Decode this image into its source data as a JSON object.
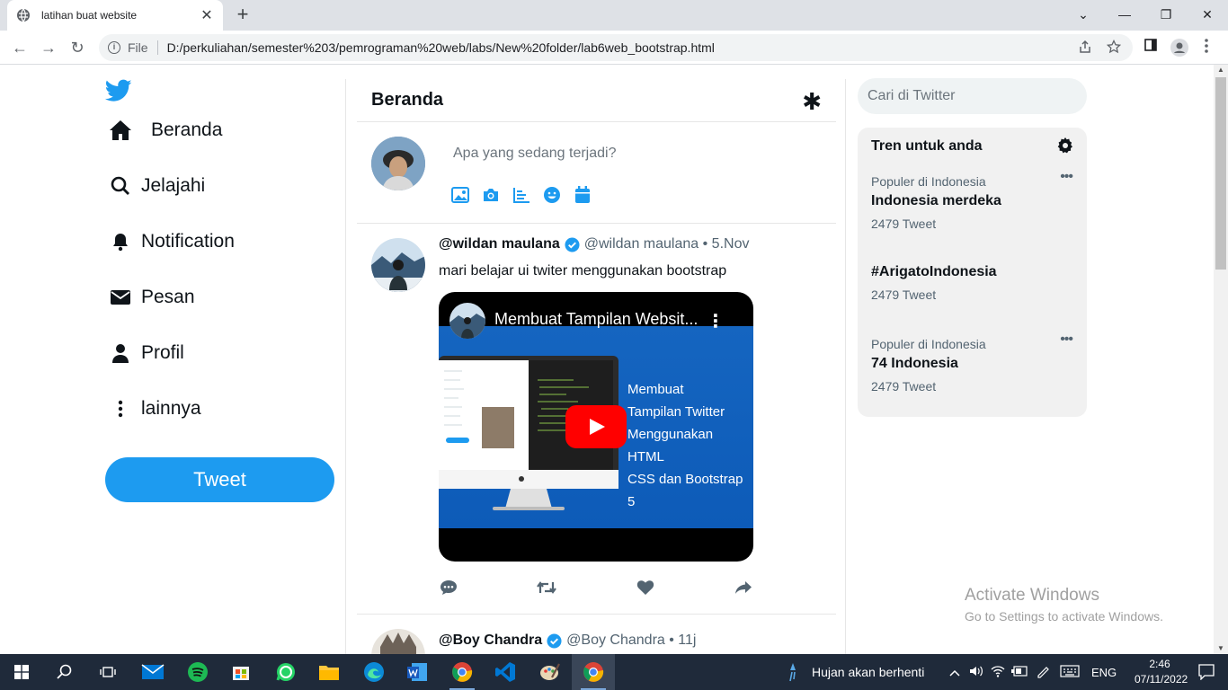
{
  "browser": {
    "tab_title": "latihan buat website",
    "tab_close": "✕",
    "new_tab": "+",
    "window_controls": [
      "⌄",
      "—",
      "❐",
      "✕"
    ],
    "nav": {
      "back": "←",
      "forward": "→",
      "reload": "↻"
    },
    "file_label": "File",
    "url": "D:/perkuliahan/semester%203/pemrograman%20web/labs/New%20folder/lab6web_bootstrap.html",
    "icons": [
      "share-icon",
      "star-icon",
      "sidebar-icon",
      "profile-icon",
      "menu-icon"
    ]
  },
  "sidebar": {
    "items": [
      {
        "label": "Beranda",
        "icon": "home-icon"
      },
      {
        "label": "Jelajahi",
        "icon": "search-icon"
      },
      {
        "label": "Notification",
        "icon": "bell-icon"
      },
      {
        "label": "Pesan",
        "icon": "envelope-icon"
      },
      {
        "label": "Profil",
        "icon": "person-icon"
      },
      {
        "label": "lainnya",
        "icon": "more-vertical-icon"
      }
    ],
    "tweet_button": "Tweet"
  },
  "main": {
    "title": "Beranda",
    "sparkle": "✱",
    "compose_placeholder": "Apa yang sedang terjadi?",
    "compose_tools": [
      "image-icon",
      "camera-icon",
      "poll-icon",
      "emoji-icon",
      "calendar-icon"
    ],
    "tweets": [
      {
        "name": "@wildan maulana",
        "handle": "@wildan maulana • 5.Nov",
        "text": "mari belajar ui twiter menggunakan bootstrap",
        "video": {
          "title": "Membuat Tampilan Websit...",
          "menu": "⋮",
          "caption": [
            "Membuat",
            "Tampilan Twitter",
            "Menggunakan HTML",
            "CSS dan Bootstrap 5"
          ]
        }
      },
      {
        "name": "@Boy Chandra",
        "handle": "@Boy Chandra • 11j"
      }
    ]
  },
  "right": {
    "search_placeholder": "Cari di Twitter",
    "trends_title": "Tren untuk anda",
    "trends": [
      {
        "context": "Populer di Indonesia",
        "name": "Indonesia merdeka",
        "count": "2479 Tweet"
      },
      {
        "context": "",
        "name": "#ArigatoIndonesia",
        "count": "2479 Tweet"
      },
      {
        "context": "Populer di Indonesia",
        "name": "74 Indonesia",
        "count": "2479 Tweet"
      }
    ],
    "more": "•••"
  },
  "watermark": {
    "line1": "Activate Windows",
    "line2": "Go to Settings to activate Windows."
  },
  "taskbar": {
    "apps": [
      "windows-start-icon",
      "search-icon",
      "task-view-icon",
      "mail-icon",
      "spotify-icon",
      "store-icon",
      "whatsapp-icon",
      "file-explorer-icon",
      "edge-icon",
      "word-icon",
      "chrome-icon",
      "vscode-icon",
      "paint-icon",
      "chrome-active-icon"
    ],
    "weather": "Hujan akan berhenti",
    "language": "ENG",
    "time": "2:46",
    "date": "07/11/2022"
  },
  "colors": {
    "accent": "#1d9bf0",
    "taskbar": "#1f2a3a"
  }
}
